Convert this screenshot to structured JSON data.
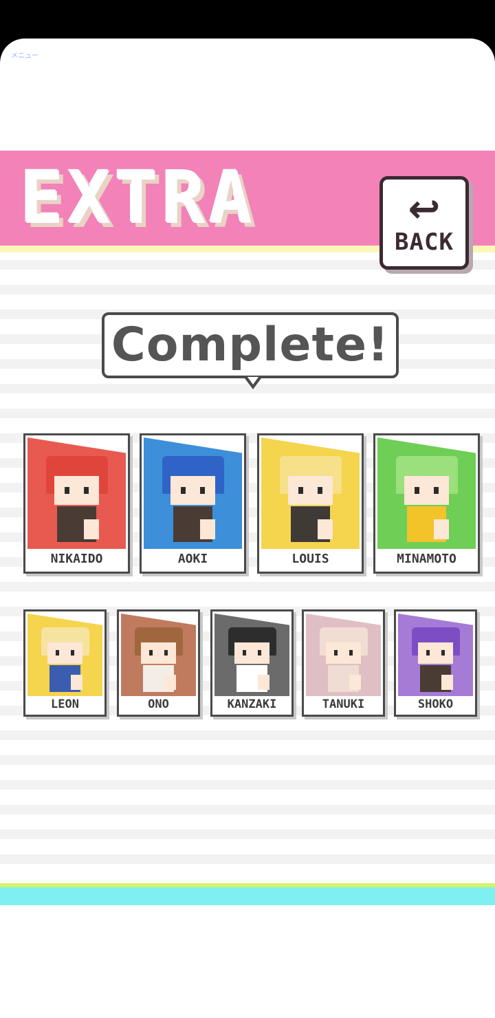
{
  "system": {
    "menu_label": "メニュー"
  },
  "header": {
    "title": "EXTRA",
    "back_label": "BACK",
    "back_icon": "return-arrow-icon"
  },
  "status": {
    "message": "Complete!"
  },
  "colors": {
    "header_pink": "#f282b8",
    "header_yellow": "#fbf7b8",
    "bottom_lime": "#d4f26a",
    "bottom_cyan": "#7ef0f2"
  },
  "characters": {
    "row1": [
      {
        "name": "NIKAIDO",
        "bg": "#e85a4f",
        "hair": "#e0453c",
        "shirt": "#4a3b34"
      },
      {
        "name": "AOKI",
        "bg": "#3d8fd9",
        "hair": "#2f63c6",
        "shirt": "#4a3b34"
      },
      {
        "name": "LOUIS",
        "bg": "#f5d44e",
        "hair": "#f7e08a",
        "shirt": "#3f3a36"
      },
      {
        "name": "MINAMOTO",
        "bg": "#6fce55",
        "hair": "#9be07c",
        "shirt": "#f3c32a"
      }
    ],
    "row2": [
      {
        "name": "LEON",
        "bg": "#f5d44e",
        "hair": "#f6e3a0",
        "shirt": "#3a5db0"
      },
      {
        "name": "ONO",
        "bg": "#c07a5e",
        "hair": "#a0673f",
        "shirt": "#f2ede6"
      },
      {
        "name": "KANZAKI",
        "bg": "#6b6b6b",
        "hair": "#2d2d2d",
        "shirt": "#ffffff"
      },
      {
        "name": "TANUKI",
        "bg": "#e0bfc4",
        "hair": "#f1ddd4",
        "shirt": "#efdcd3"
      },
      {
        "name": "SHOKO",
        "bg": "#a57bd6",
        "hair": "#7c4ec4",
        "shirt": "#4a3b34"
      }
    ]
  }
}
